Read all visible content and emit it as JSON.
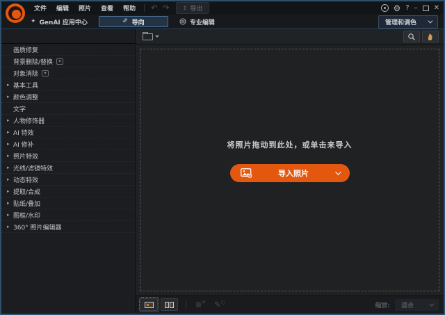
{
  "titlebar": {
    "menus": [
      "文件",
      "编辑",
      "照片",
      "查看",
      "帮助"
    ],
    "export_label": "导出"
  },
  "modebar": {
    "genai_label": "GenAI 应用中心",
    "guided_label": "导向",
    "expert_label": "专业编辑",
    "manage_label": "管理和调色"
  },
  "sidebar": {
    "items": [
      {
        "label": "画质修复",
        "expandable": false,
        "ai_badge": false
      },
      {
        "label": "背景删除/替换",
        "expandable": false,
        "ai_badge": true
      },
      {
        "label": "对象消除",
        "expandable": false,
        "ai_badge": true
      },
      {
        "label": "基本工具",
        "expandable": true,
        "ai_badge": false
      },
      {
        "label": "颜色调整",
        "expandable": true,
        "ai_badge": false
      },
      {
        "label": "文字",
        "expandable": false,
        "ai_badge": false
      },
      {
        "label": "人物修饰器",
        "expandable": true,
        "ai_badge": false
      },
      {
        "label": "AI 特效",
        "expandable": true,
        "ai_badge": false
      },
      {
        "label": "AI 修补",
        "expandable": true,
        "ai_badge": false
      },
      {
        "label": "照片特效",
        "expandable": true,
        "ai_badge": false
      },
      {
        "label": "光线/滤镜特效",
        "expandable": true,
        "ai_badge": false
      },
      {
        "label": "动态特效",
        "expandable": true,
        "ai_badge": false
      },
      {
        "label": "提取/合成",
        "expandable": true,
        "ai_badge": false
      },
      {
        "label": "贴纸/叠加",
        "expandable": true,
        "ai_badge": false
      },
      {
        "label": "图框/水印",
        "expandable": true,
        "ai_badge": false
      },
      {
        "label": "360° 照片编辑器",
        "expandable": true,
        "ai_badge": false
      }
    ]
  },
  "canvas": {
    "drop_hint": "将照片拖动到此处，或单击来导入",
    "import_label": "导入照片"
  },
  "statusbar": {
    "zoom_label": "缩放:",
    "zoom_value": "适合"
  },
  "icons": {
    "expand_arrow": "▸",
    "sparkle": "✦",
    "ai_badge": "✦",
    "gear": "⚙",
    "help": "?",
    "undo": "↶",
    "redo": "↷",
    "export_arrow": "↥",
    "wand": "✎",
    "minimize": "–",
    "close": "✕",
    "layers": "≣",
    "pen": "✎",
    "pen_dot": "○"
  },
  "colors": {
    "accent": "#e4570f",
    "guided_border": "#4e7094",
    "window_border": "#2e5170"
  }
}
